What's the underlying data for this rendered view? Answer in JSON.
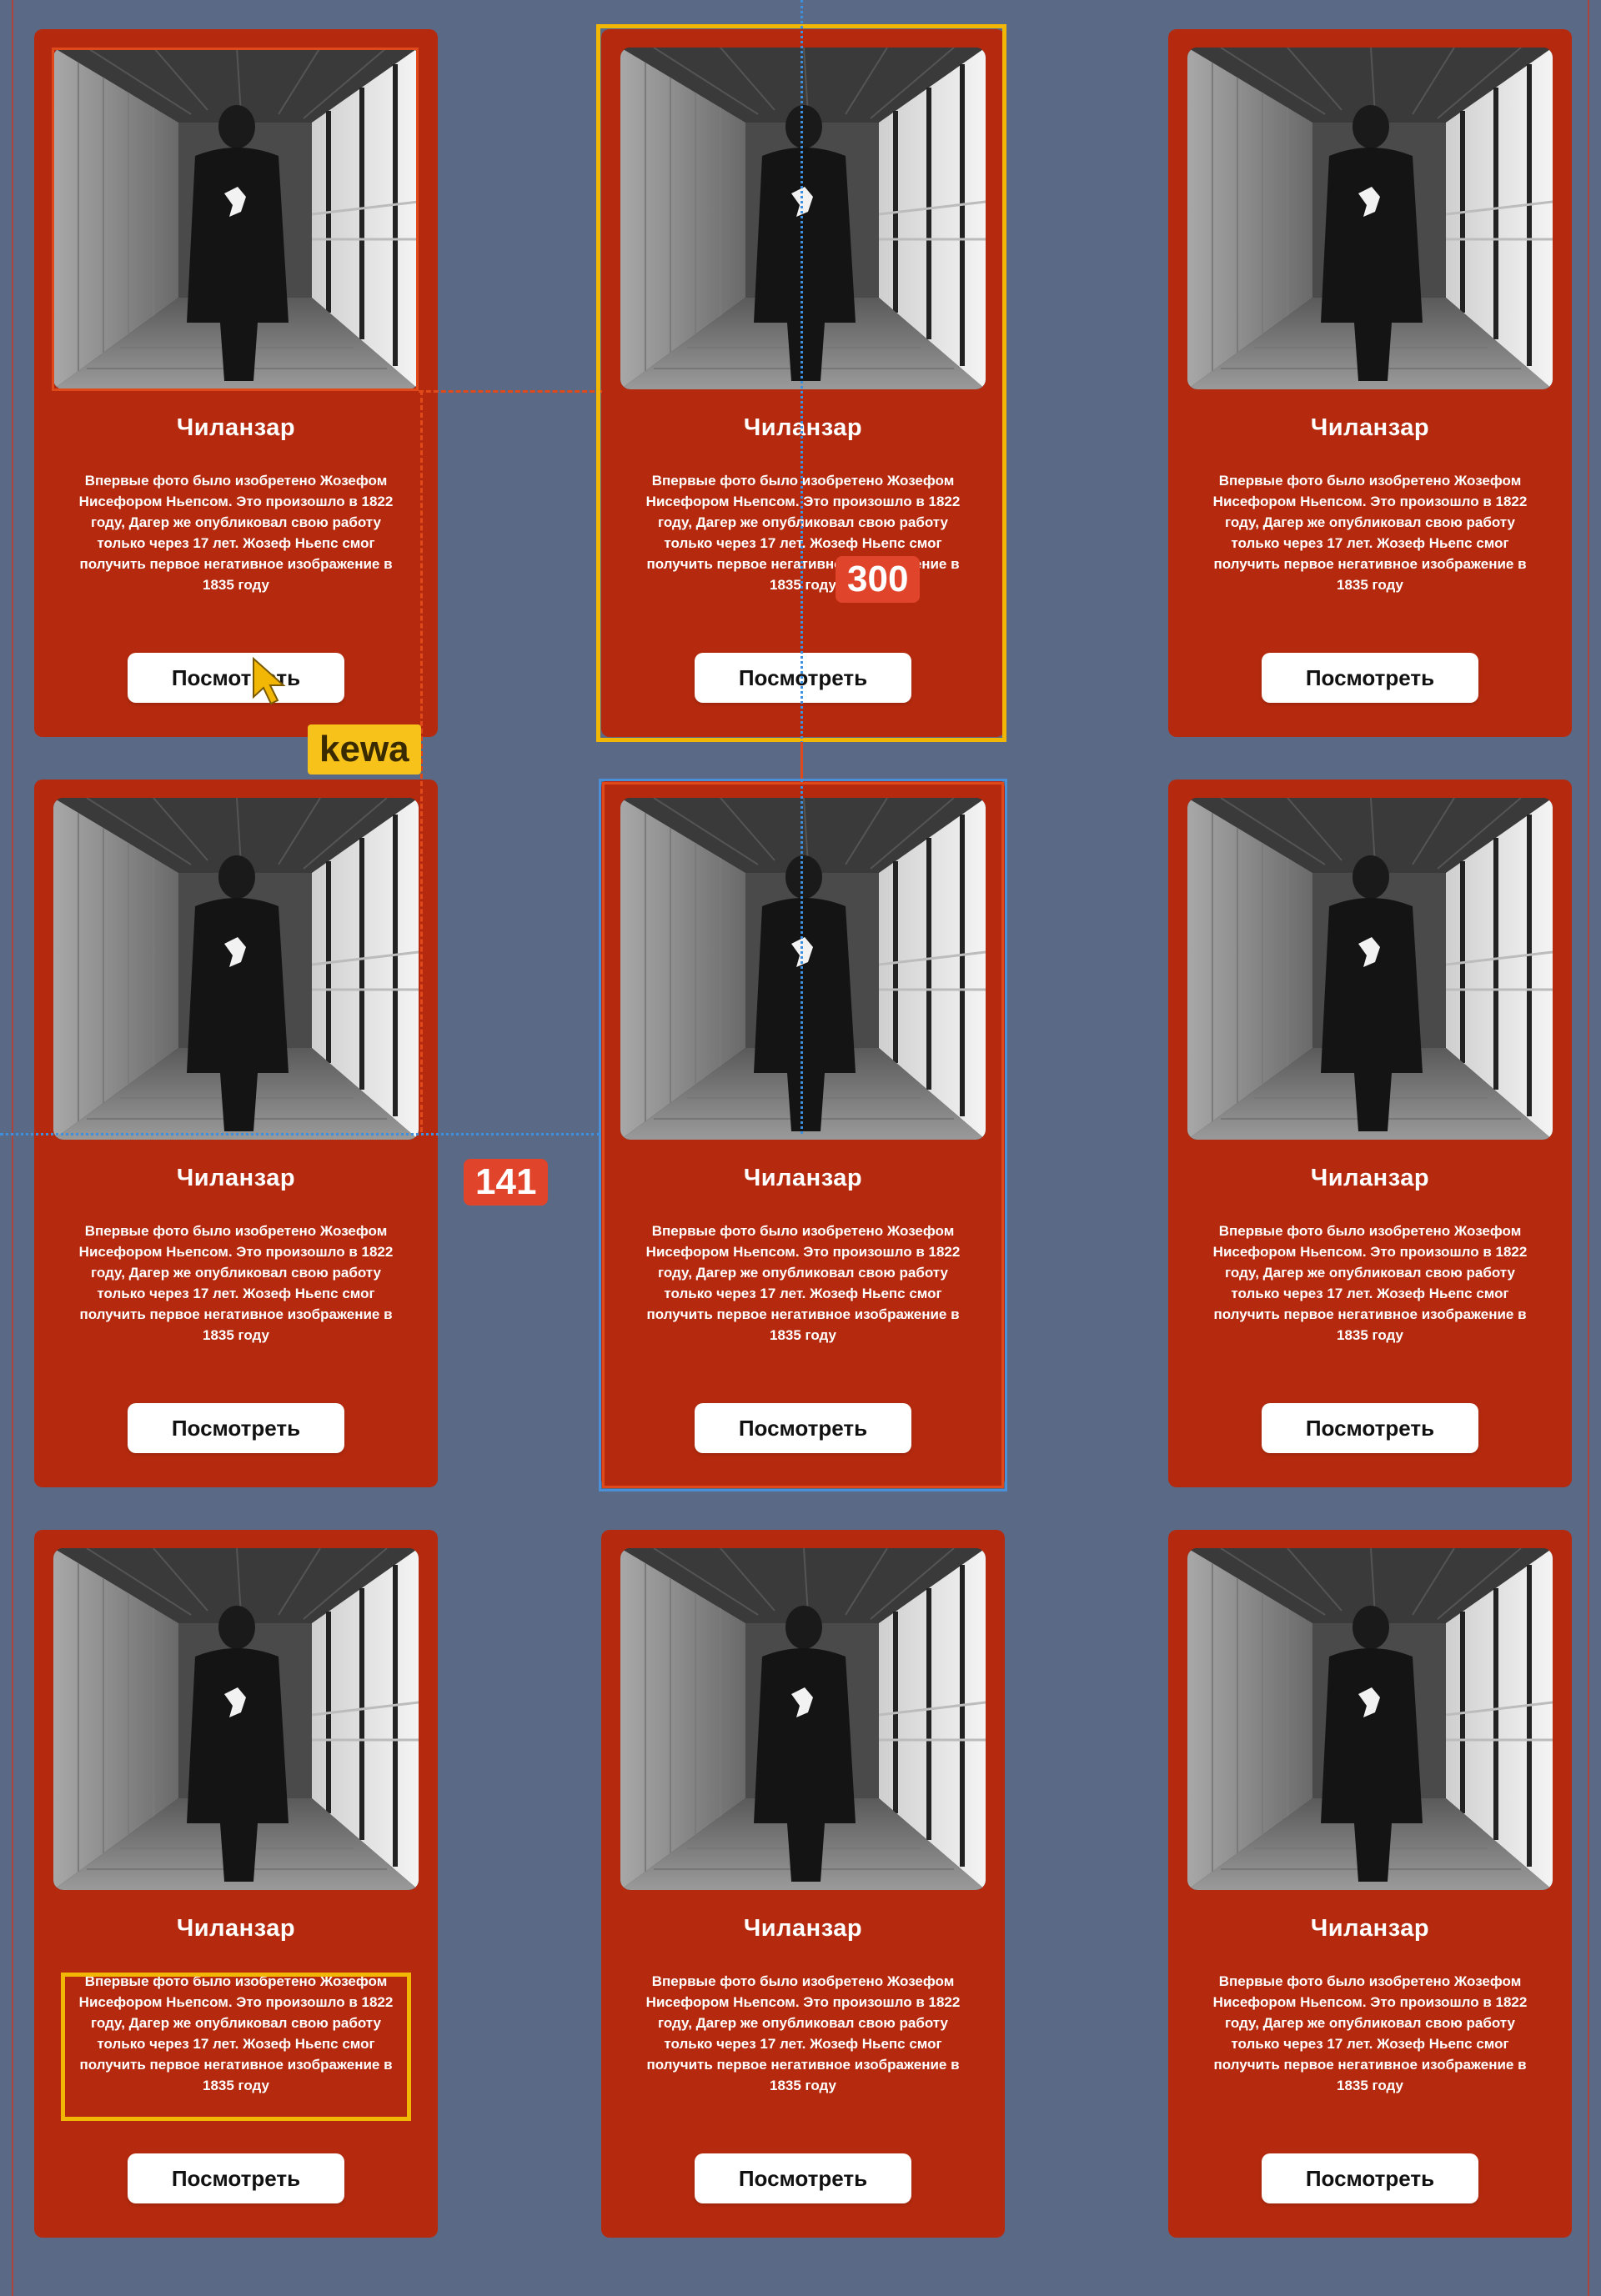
{
  "colors": {
    "canvas_background": "#5a6a86",
    "card_background": "#b52a0e",
    "selection_yellow": "#f2b705",
    "measure_red": "#e0442a",
    "guide_blue": "#3d8fe0"
  },
  "cards": [
    {
      "title": "Чиланзар",
      "text": "Впервые фото было изобретено Жозефом Нисефором Ньепсом. Это произошло в 1822 году, Дагер же опубликовал свою работу только через 17 лет. Жозеф Ньепс смог получить первое негативное изображение в 1835 году",
      "button_label": "Посмотреть"
    },
    {
      "title": "Чиланзар",
      "text": "Впервые фото было изобретено Жозефом Нисефором Ньепсом. Это произошло в 1822 году, Дагер же опубликовал свою работу только через 17 лет. Жозеф Ньепс смог получить первое негативное изображение в 1835 году",
      "button_label": "Посмотреть"
    },
    {
      "title": "Чиланзар",
      "text": "Впервые фото было изобретено Жозефом Нисефором Ньепсом. Это произошло в 1822 году, Дагер же опубликовал свою работу только через 17 лет. Жозеф Ньепс смог получить первое негативное изображение в 1835 году",
      "button_label": "Посмотреть"
    },
    {
      "title": "Чиланзар",
      "text": "Впервые фото было изобретено Жозефом Нисефором Ньепсом. Это произошло в 1822 году, Дагер же опубликовал свою работу только через 17 лет. Жозеф Ньепс смог получить первое негативное изображение в 1835 году",
      "button_label": "Посмотреть"
    },
    {
      "title": "Чиланзар",
      "text": "Впервые фото было изобретено Жозефом Нисефором Ньепсом. Это произошло в 1822 году, Дагер же опубликовал свою работу только через 17 лет. Жозеф Ньепс смог получить первое негативное изображение в 1835 году",
      "button_label": "Посмотреть"
    },
    {
      "title": "Чиланзар",
      "text": "Впервые фото было изобретено Жозефом Нисефором Ньепсом. Это произошло в 1822 году, Дагер же опубликовал свою работу только через 17 лет. Жозеф Ньепс смог получить первое негативное изображение в 1835 году",
      "button_label": "Посмотреть"
    },
    {
      "title": "Чиланзар",
      "text": "Впервые фото было изобретено Жозефом Нисефором Ньепсом. Это произошло в 1822 году, Дагер же опубликовал свою работу только через 17 лет. Жозеф Ньепс смог получить первое негативное изображение в 1835 году",
      "button_label": "Посмотреть"
    },
    {
      "title": "Чиланзар",
      "text": "Впервые фото было изобретено Жозефом Нисефором Ньепсом. Это произошло в 1822 году, Дагер же опубликовал свою работу только через 17 лет. Жозеф Ньепс смог получить первое негативное изображение в 1835 году",
      "button_label": "Посмотреть"
    },
    {
      "title": "Чиланзар",
      "text": "Впервые фото было изобретено Жозефом Нисефором Ньепсом. Это произошло в 1822 году, Дагер же опубликовал свою работу только через 17 лет. Жозеф Ньепс смог получить первое негативное изображение в 1835 году",
      "button_label": "Посмотреть"
    }
  ],
  "overlays": {
    "width_measure": "300",
    "gap_measure": "141",
    "layer_name_tag": "kewa"
  }
}
